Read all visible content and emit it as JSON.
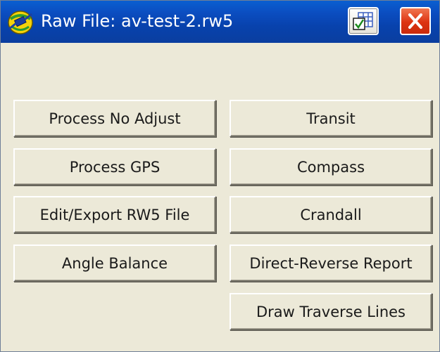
{
  "window": {
    "title": "Raw File: av-test-2.rw5",
    "icons": {
      "app": "satellite-app-icon",
      "grid": "grid-settings-icon",
      "close": "close-icon"
    },
    "colors": {
      "titlebar": "#0a4dc0",
      "close_button": "#dd3311",
      "body": "#ece9d8"
    }
  },
  "buttons": {
    "process_no_adjust": "Process No Adjust",
    "process_gps": "Process GPS",
    "edit_export_rw5": "Edit/Export RW5 File",
    "angle_balance": "Angle Balance",
    "transit": "Transit",
    "compass": "Compass",
    "crandall": "Crandall",
    "direct_reverse_report": "Direct-Reverse Report",
    "draw_traverse_lines": "Draw Traverse Lines"
  }
}
